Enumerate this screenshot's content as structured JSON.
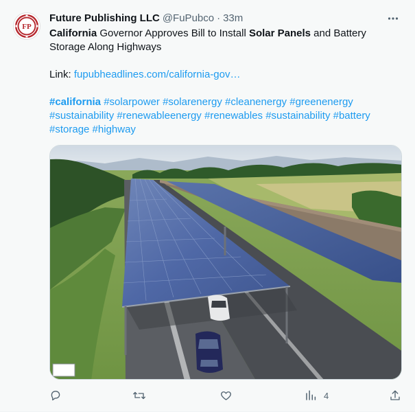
{
  "author": {
    "name": "Future Publishing LLC",
    "handle": "@FuPubco",
    "separator": "·",
    "time": "33m",
    "avatar_text": "FP"
  },
  "post": {
    "headline_parts": [
      {
        "text": "California",
        "bold": true
      },
      {
        "text": " Governor Approves Bill to Install ",
        "bold": false
      },
      {
        "text": "Solar Panels",
        "bold": true
      },
      {
        "text": " and Battery",
        "bold": false
      }
    ],
    "headline_line2": "Storage Along Highways",
    "link_label": "Link: ",
    "link_text": "fupubheadlines.com/california-gov…",
    "hashtags_line1": [
      "#california",
      "#solarpower",
      "#solarenergy",
      "#cleanenergy",
      "#greenenergy"
    ],
    "hashtags_line2": [
      "#sustainability",
      "#renewableenergy",
      "#renewables",
      "#sustainability",
      "#battery"
    ],
    "hashtags_line3": [
      "#storage",
      "#highway"
    ]
  },
  "actions": {
    "reply_icon": "reply-icon",
    "retweet_icon": "retweet-icon",
    "like_icon": "heart-icon",
    "views_icon": "views-icon",
    "views_count": "4",
    "share_icon": "share-icon"
  },
  "colors": {
    "accent": "#1d9bf0",
    "text_primary": "#0f1419",
    "text_secondary": "#536471",
    "avatar_brand": "#b5272d"
  }
}
